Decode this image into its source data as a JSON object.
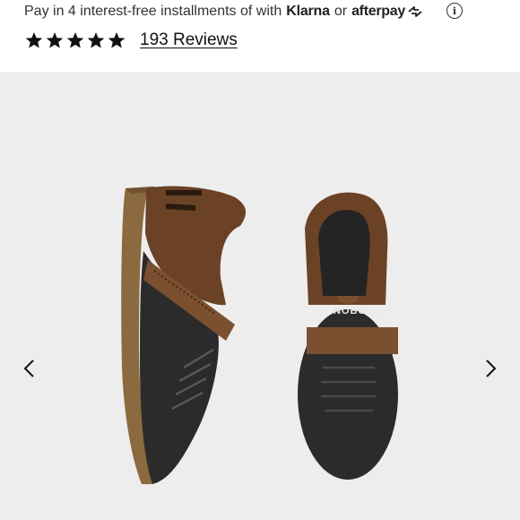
{
  "payment": {
    "text": "Pay in 4 interest-free installments of with",
    "klarna": "Klarna",
    "or": "or",
    "afterpay": "afterpay",
    "info_icon": "info-icon"
  },
  "rating": {
    "stars": 5,
    "max_stars": 5,
    "reviews_label": "193 Reviews"
  },
  "gallery": {
    "image_label": "NOBULL",
    "colors": {
      "background": "#ededed",
      "leather": "#6b4226",
      "mesh": "#2b2b2b"
    },
    "prev_icon": "chevron-left-icon",
    "next_icon": "chevron-right-icon"
  }
}
